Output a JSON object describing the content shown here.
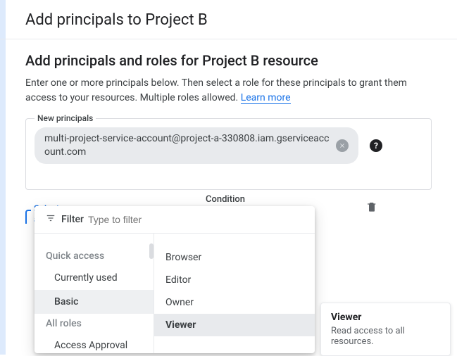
{
  "header": {
    "title": "Add principals to Project B"
  },
  "main": {
    "title": "Add principals and roles for Project B resource",
    "description": "Enter one or more principals below. Then select a role for these principals to grant them access to your resources. Multiple roles allowed.",
    "learn_more": "Learn more"
  },
  "principals": {
    "label": "New principals",
    "chip_value": "multi-project-service-account@project-a-330808.iam.gserviceaccount.com"
  },
  "role": {
    "select_label": "Select a role",
    "condition_label": "Condition"
  },
  "dropdown": {
    "filter_label": "Filter",
    "filter_placeholder": "Type to filter",
    "left": {
      "section_quick": "Quick access",
      "items_quick": [
        "Currently used",
        "Basic"
      ],
      "section_all": "All roles",
      "items_all": [
        "Access Approval"
      ],
      "selected": "Basic"
    },
    "right": {
      "roles": [
        "Browser",
        "Editor",
        "Owner",
        "Viewer"
      ],
      "selected": "Viewer"
    }
  },
  "tooltip": {
    "title": "Viewer",
    "desc": "Read access to all resources."
  }
}
